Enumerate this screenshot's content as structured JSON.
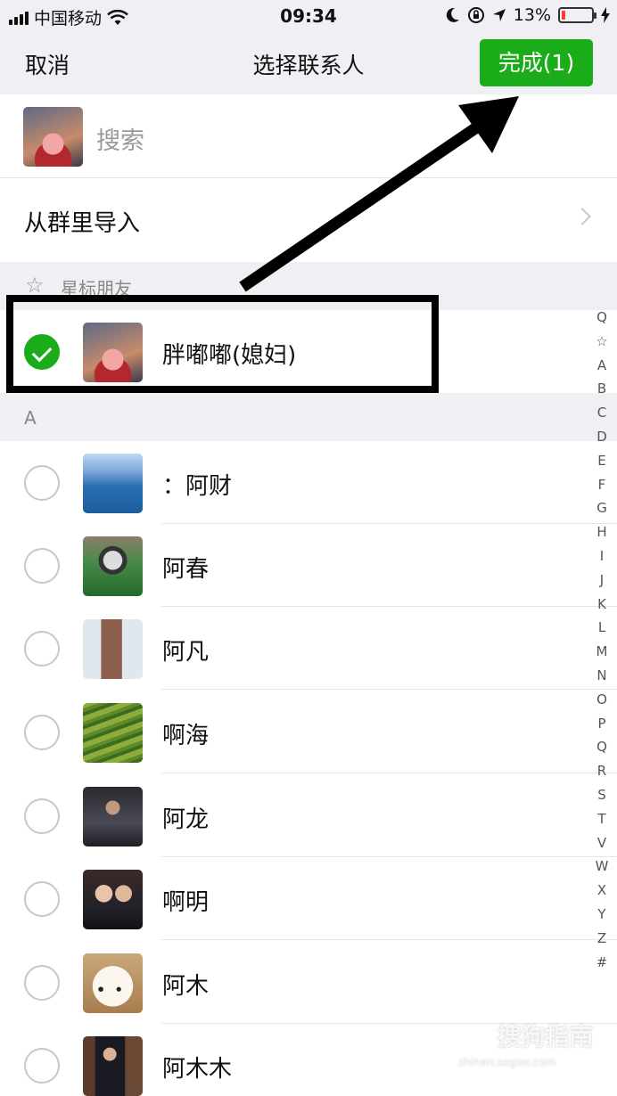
{
  "status_bar": {
    "carrier": "中国移动",
    "time": "09:34",
    "battery_percent": "13%",
    "battery_level": 0.13,
    "icons": [
      "signal-icon",
      "wifi-icon",
      "moon-icon",
      "rotation-lock-icon",
      "location-icon",
      "battery-icon",
      "charging-icon"
    ]
  },
  "nav": {
    "cancel_label": "取消",
    "title": "选择联系人",
    "done_label": "完成(1)",
    "done_color": "#1aad19"
  },
  "search": {
    "placeholder": "搜索"
  },
  "import_group": {
    "label": "从群里导入"
  },
  "sections": {
    "starred": "星标朋友",
    "a": "A"
  },
  "contacts": {
    "starred": [
      {
        "name": "胖嘟嘟(媳妇)",
        "checked": true,
        "avatar": "pig-avatar"
      }
    ],
    "a": [
      {
        "name": "：阿财",
        "checked": false,
        "avatar": "lake-avatar"
      },
      {
        "name": "阿春",
        "checked": false,
        "avatar": "ball-avatar"
      },
      {
        "name": "阿凡",
        "checked": false,
        "avatar": "tower-avatar"
      },
      {
        "name": "啊海",
        "checked": false,
        "avatar": "terrace-avatar"
      },
      {
        "name": "阿龙",
        "checked": false,
        "avatar": "man-avatar"
      },
      {
        "name": "啊明",
        "checked": false,
        "avatar": "couple-avatar"
      },
      {
        "name": "阿木",
        "checked": false,
        "avatar": "dog-avatar"
      },
      {
        "name": "阿木木",
        "checked": false,
        "avatar": "suit-avatar"
      }
    ]
  },
  "index_bar": [
    "Q",
    "☆",
    "A",
    "B",
    "C",
    "D",
    "E",
    "F",
    "G",
    "H",
    "I",
    "J",
    "K",
    "L",
    "M",
    "N",
    "O",
    "P",
    "Q",
    "R",
    "S",
    "T",
    "V",
    "W",
    "X",
    "Y",
    "Z",
    "#"
  ],
  "watermark": {
    "brand": "搜狗指南",
    "url": "zhinan.sogou.com"
  }
}
